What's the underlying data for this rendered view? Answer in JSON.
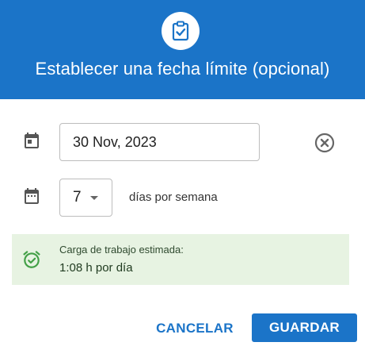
{
  "header": {
    "title": "Establecer una fecha límite (opcional)",
    "icon": "clipboard-check-icon",
    "background_color": "#1b74c8"
  },
  "due_date": {
    "icon": "calendar-icon",
    "value": "30 Nov, 2023",
    "clear_icon": "clear-circle-icon"
  },
  "days_per_week": {
    "icon": "calendar-week-icon",
    "value": "7",
    "suffix": "días por semana"
  },
  "workload": {
    "icon": "alarm-clock-icon",
    "label": "Carga de trabajo estimada:",
    "value": "1:08 h por día",
    "background_color": "#e7f3e2",
    "icon_color": "#43a047"
  },
  "actions": {
    "cancel_label": "CANCELAR",
    "save_label": "GUARDAR",
    "accent_color": "#1b74c8"
  }
}
